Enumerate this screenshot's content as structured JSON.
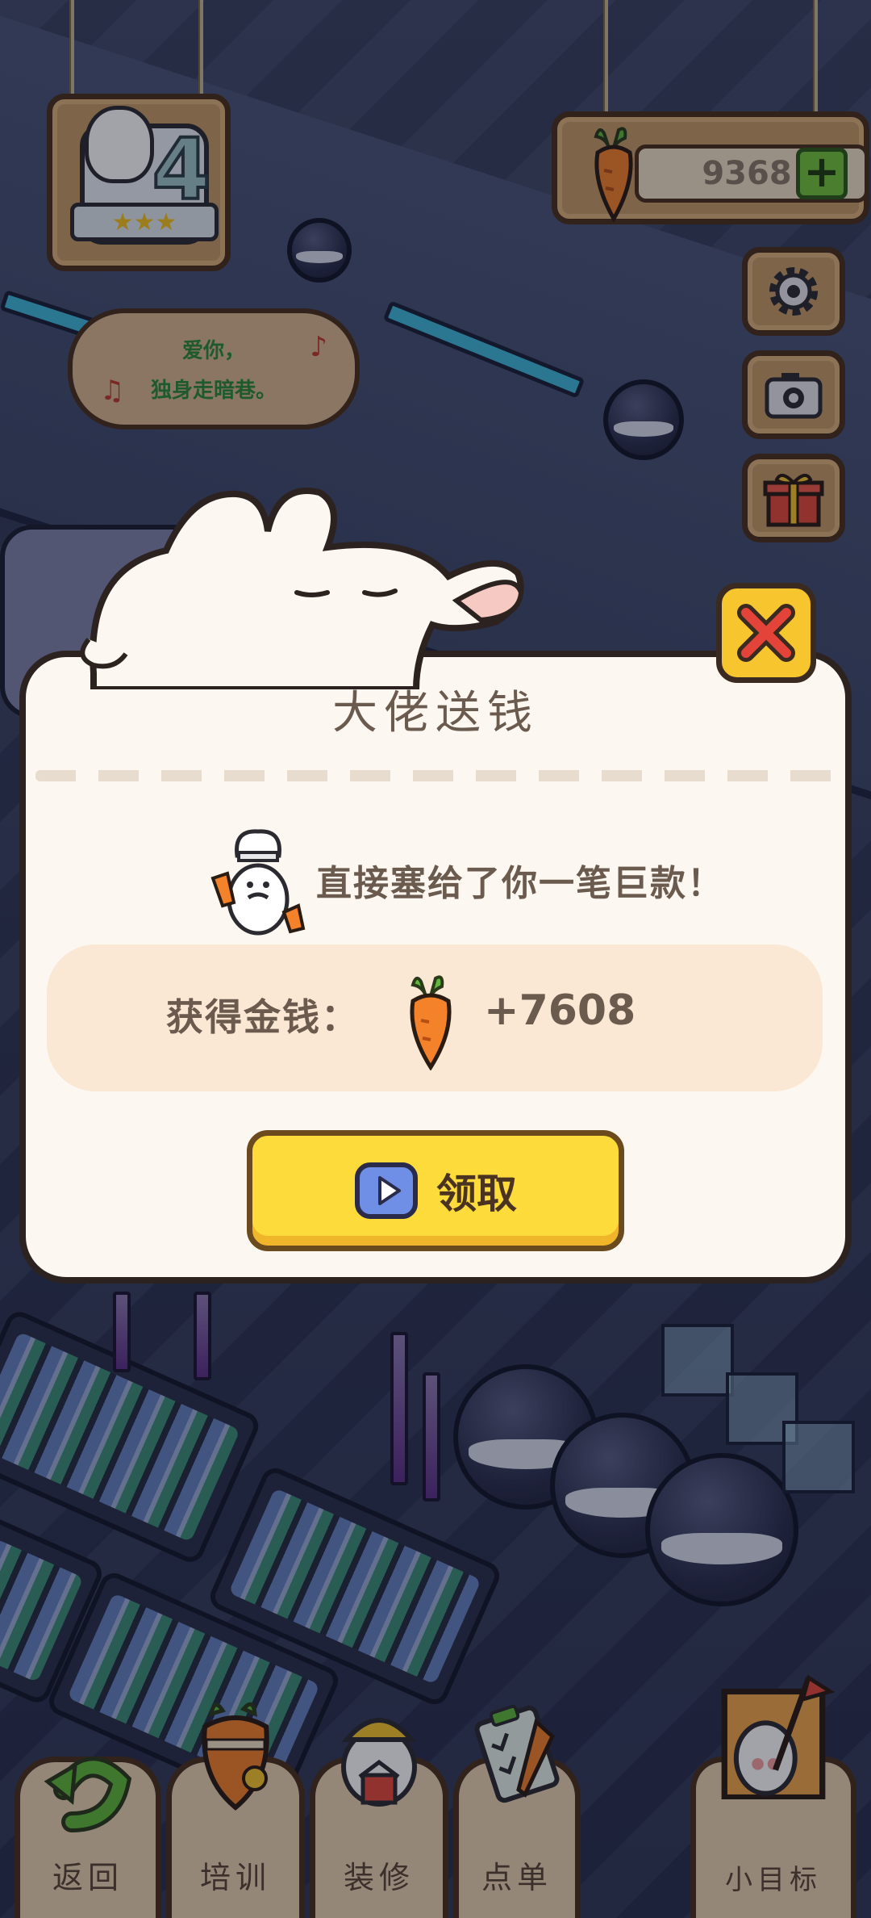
{
  "hud": {
    "level": "4",
    "stars": "★★★",
    "lyric_line1": "爱你，",
    "lyric_line2": "独身走暗巷。",
    "lyric_note1": "♪",
    "lyric_note2": "♫",
    "carrot_count": "9368",
    "add_currency": "+"
  },
  "side_menu": [
    "settings-icon",
    "camera-icon",
    "gift-icon"
  ],
  "modal": {
    "title": "大佬送钱",
    "gift_text": "直接塞给了你一笔巨款！",
    "reward_label": "获得金钱：",
    "reward_amount": "+7608",
    "claim_label": "领取"
  },
  "bottom_nav": {
    "back": "返回",
    "train": "培训",
    "decorate": "装修",
    "order": "点单",
    "goal": "小目标"
  },
  "colors": {
    "modal_bg": "#fcf8f1",
    "claim_button": "#fddb3a",
    "close_button": "#f7c52d",
    "reward_panel": "#fbe8d4",
    "text_brown": "#6b5a4e",
    "lyric_green": "#2c8a3b"
  }
}
